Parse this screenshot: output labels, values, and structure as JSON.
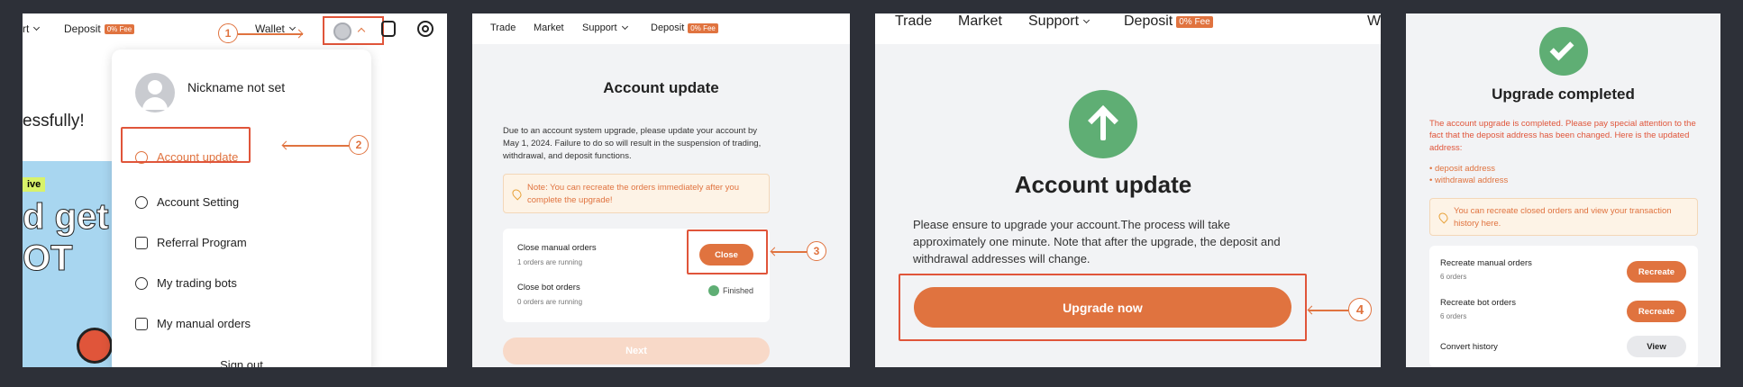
{
  "panel1": {
    "nav": {
      "port_fragment": "rt",
      "deposit": "Deposit",
      "fee_badge": "0% Fee",
      "wallet": "Wallet"
    },
    "bg_text": {
      "success_fragment": "essfully!",
      "live_badge": "ive",
      "promo_big": "d get",
      "promo_big2": "OT"
    },
    "menu": {
      "nickname": "Nickname not set",
      "items": [
        {
          "label": "Account update"
        },
        {
          "label": "Account Setting"
        },
        {
          "label": "Referral Program"
        },
        {
          "label": "My trading bots"
        },
        {
          "label": "My manual orders"
        }
      ],
      "sign_out": "Sign out"
    },
    "step1": "1",
    "step2": "2"
  },
  "panel2": {
    "nav": {
      "trade": "Trade",
      "market": "Market",
      "support": "Support",
      "deposit": "Deposit",
      "fee_badge": "0% Fee"
    },
    "title": "Account update",
    "description": "Due to an account system upgrade, please update your account by May 1, 2024. Failure to do so will result in the suspension of trading, withdrawal, and deposit functions.",
    "note": "Note: You can recreate the orders immediately after you complete the upgrade!",
    "rows": [
      {
        "title": "Close manual orders",
        "sub": "1 orders are running",
        "action": "Close"
      },
      {
        "title": "Close bot orders",
        "sub": "0 orders are running",
        "action": "Finished"
      }
    ],
    "next": "Next",
    "step3": "3"
  },
  "panel3": {
    "nav": {
      "trade": "Trade",
      "market": "Market",
      "support": "Support",
      "deposit": "Deposit",
      "fee_badge": "0% Fee",
      "cut": "W"
    },
    "title": "Account update",
    "description": "Please ensure to upgrade your account.The process will take approximately one minute. Note that after the upgrade, the deposit and withdrawal addresses will change.",
    "button": "Upgrade now",
    "step4": "4"
  },
  "panel4": {
    "title": "Upgrade completed",
    "warning": "The account upgrade is completed. Please pay special attention to the fact that the deposit address has been changed. Here is the updated address:",
    "bullets": [
      "deposit address",
      "withdrawal address"
    ],
    "note": "You can recreate closed orders and view your transaction history here.",
    "rows": [
      {
        "title": "Recreate manual orders",
        "sub": "6 orders",
        "action": "Recreate"
      },
      {
        "title": "Recreate bot orders",
        "sub": "6 orders",
        "action": "Recreate"
      },
      {
        "title": "Convert history",
        "sub": "",
        "action": "View"
      }
    ]
  },
  "colors": {
    "accent": "#e0733f",
    "highlight": "#e0553a",
    "success": "#5fae74",
    "background": "#2d3038"
  }
}
